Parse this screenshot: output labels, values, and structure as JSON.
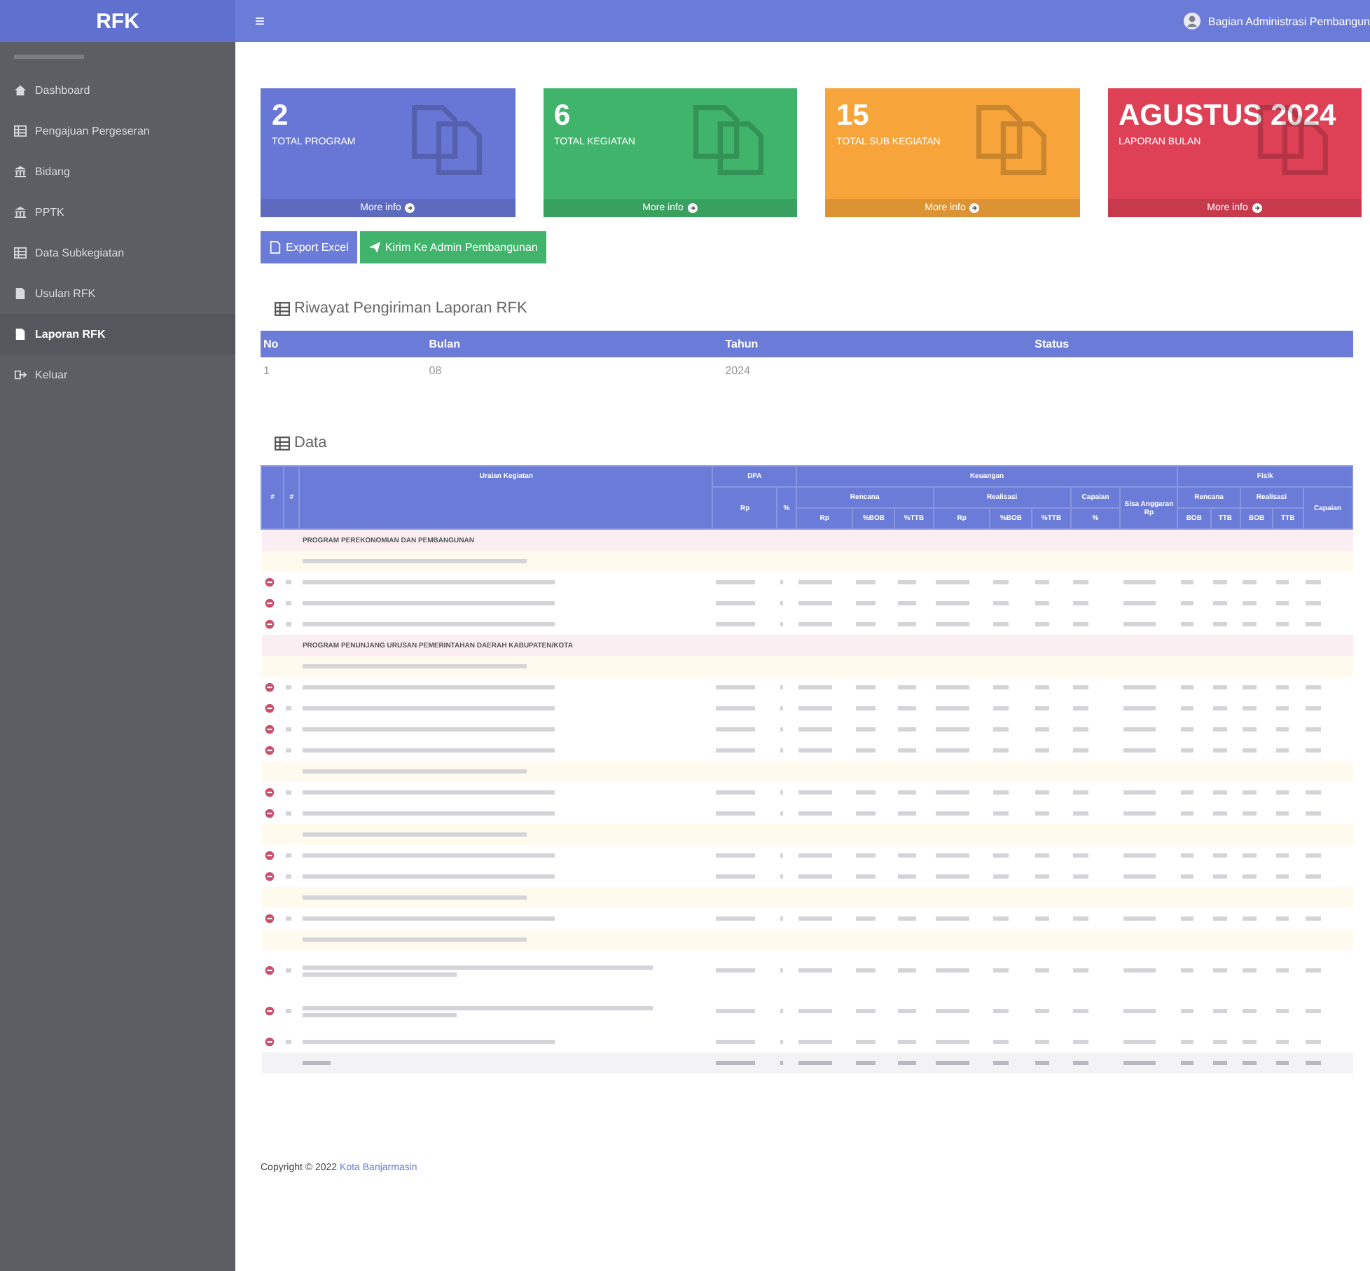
{
  "header": {
    "brand": "RFK",
    "menu_icon": "≡",
    "user": "Bagian Administrasi Pembangun"
  },
  "sidebar": {
    "items": [
      {
        "label": "Dashboard",
        "kind": "home",
        "selected": false
      },
      {
        "label": "Pengajuan Pergeseran",
        "kind": "list",
        "selected": false
      },
      {
        "label": "Bidang",
        "kind": "office",
        "selected": false
      },
      {
        "label": "PPTK",
        "kind": "office",
        "selected": false
      },
      {
        "label": "Data Subkegiatan",
        "kind": "list",
        "selected": false
      },
      {
        "label": "Usulan RFK",
        "kind": "file",
        "selected": false
      },
      {
        "label": "Laporan RFK",
        "kind": "file",
        "selected": true
      },
      {
        "label": "Keluar",
        "kind": "exit",
        "selected": false
      }
    ]
  },
  "cards": [
    {
      "value": "2",
      "label": "TOTAL PROGRAM",
      "link": "More info",
      "color": "#6877d6"
    },
    {
      "value": "6",
      "label": "TOTAL KEGIATAN",
      "link": "More info",
      "color": "#3fb46a"
    },
    {
      "value": "15",
      "label": "TOTAL SUB KEGIATAN",
      "link": "More info",
      "color": "#f7a43a"
    },
    {
      "value": "AGUSTUS 2024",
      "label": "LAPORAN BULAN",
      "link": "More info",
      "color": "#de4056"
    }
  ],
  "buttons": [
    {
      "label": "Export Excel",
      "kind": "export"
    },
    {
      "label": "Kirim Ke Admin Pembangunan",
      "kind": "send"
    }
  ],
  "history": {
    "title": "Riwayat Pengiriman Laporan RFK",
    "columns": [
      "No",
      "Bulan",
      "Tahun",
      "Status"
    ],
    "rows": [
      [
        "1",
        "08",
        "2024",
        ""
      ]
    ]
  },
  "data": {
    "title": "Data",
    "header_top": [
      "#",
      "#",
      "Uraian Kegiatan",
      "DPA",
      "Keuangan",
      "Fisik"
    ],
    "header_mid": [
      "Rp",
      "%",
      "Rencana",
      "Realisasi",
      "Capaian",
      "Sisa Anggaran Rp",
      "Rencana",
      "Realisasi",
      "Capaian"
    ],
    "header_low": [
      "Rp",
      "%BOB",
      "%TTB",
      "Rp",
      "%BOB",
      "%TTB",
      "%",
      "BOB",
      "TTB",
      "BOB",
      "TTB"
    ],
    "rows": [
      {
        "kind": "program",
        "label": "PROGRAM PEREKONOMIAN DAN PEMBANGUNAN"
      },
      {
        "kind": "kegiatan"
      },
      {
        "kind": "sub"
      },
      {
        "kind": "sub"
      },
      {
        "kind": "sub"
      },
      {
        "kind": "program",
        "label": "PROGRAM PENUNJANG URUSAN PEMERINTAHAN DAERAH KABUPATEN/KOTA"
      },
      {
        "kind": "kegiatan"
      },
      {
        "kind": "sub"
      },
      {
        "kind": "sub"
      },
      {
        "kind": "sub"
      },
      {
        "kind": "sub"
      },
      {
        "kind": "kegiatan"
      },
      {
        "kind": "sub"
      },
      {
        "kind": "sub"
      },
      {
        "kind": "kegiatan"
      },
      {
        "kind": "sub"
      },
      {
        "kind": "sub"
      },
      {
        "kind": "kegiatan"
      },
      {
        "kind": "sub"
      },
      {
        "kind": "kegiatan"
      },
      {
        "kind": "sub_tall"
      },
      {
        "kind": "sub_tall"
      },
      {
        "kind": "sub"
      },
      {
        "kind": "total"
      }
    ]
  },
  "footer": {
    "text": "Copyright © 2022",
    "link": "Kota Banjarmasin"
  }
}
